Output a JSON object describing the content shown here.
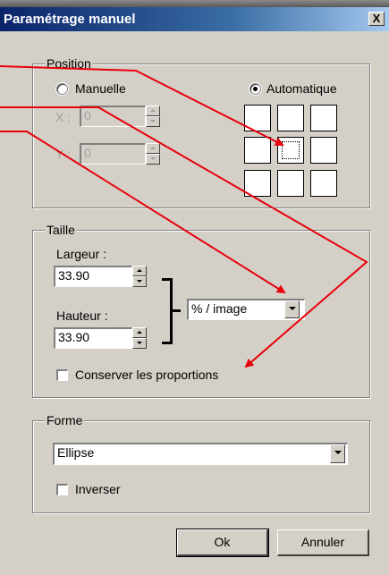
{
  "dialog": {
    "title": "Paramétrage manuel",
    "close_label": "X"
  },
  "position": {
    "legend": "Position",
    "manuelle_label": "Manuelle",
    "automatique_label": "Automatique",
    "selected": "Automatique",
    "x_label": "X :",
    "x_value": "0",
    "y_label": "Y :",
    "y_value": "0",
    "grid_selected_index": 4
  },
  "taille": {
    "legend": "Taille",
    "largeur_label": "Largeur :",
    "largeur_value": "33.90",
    "hauteur_label": "Hauteur :",
    "hauteur_value": "33.90",
    "unit_value": "% / image",
    "conserver_label": "Conserver les proportions",
    "conserver_checked": false
  },
  "forme": {
    "legend": "Forme",
    "shape_value": "Ellipse",
    "inverser_label": "Inverser",
    "inverser_checked": false
  },
  "buttons": {
    "ok": "Ok",
    "cancel": "Annuler"
  },
  "colors": {
    "annotation_arrow": "#e8000a",
    "title_bar": "#0a246a",
    "dialog_face": "#d4d0c8"
  }
}
